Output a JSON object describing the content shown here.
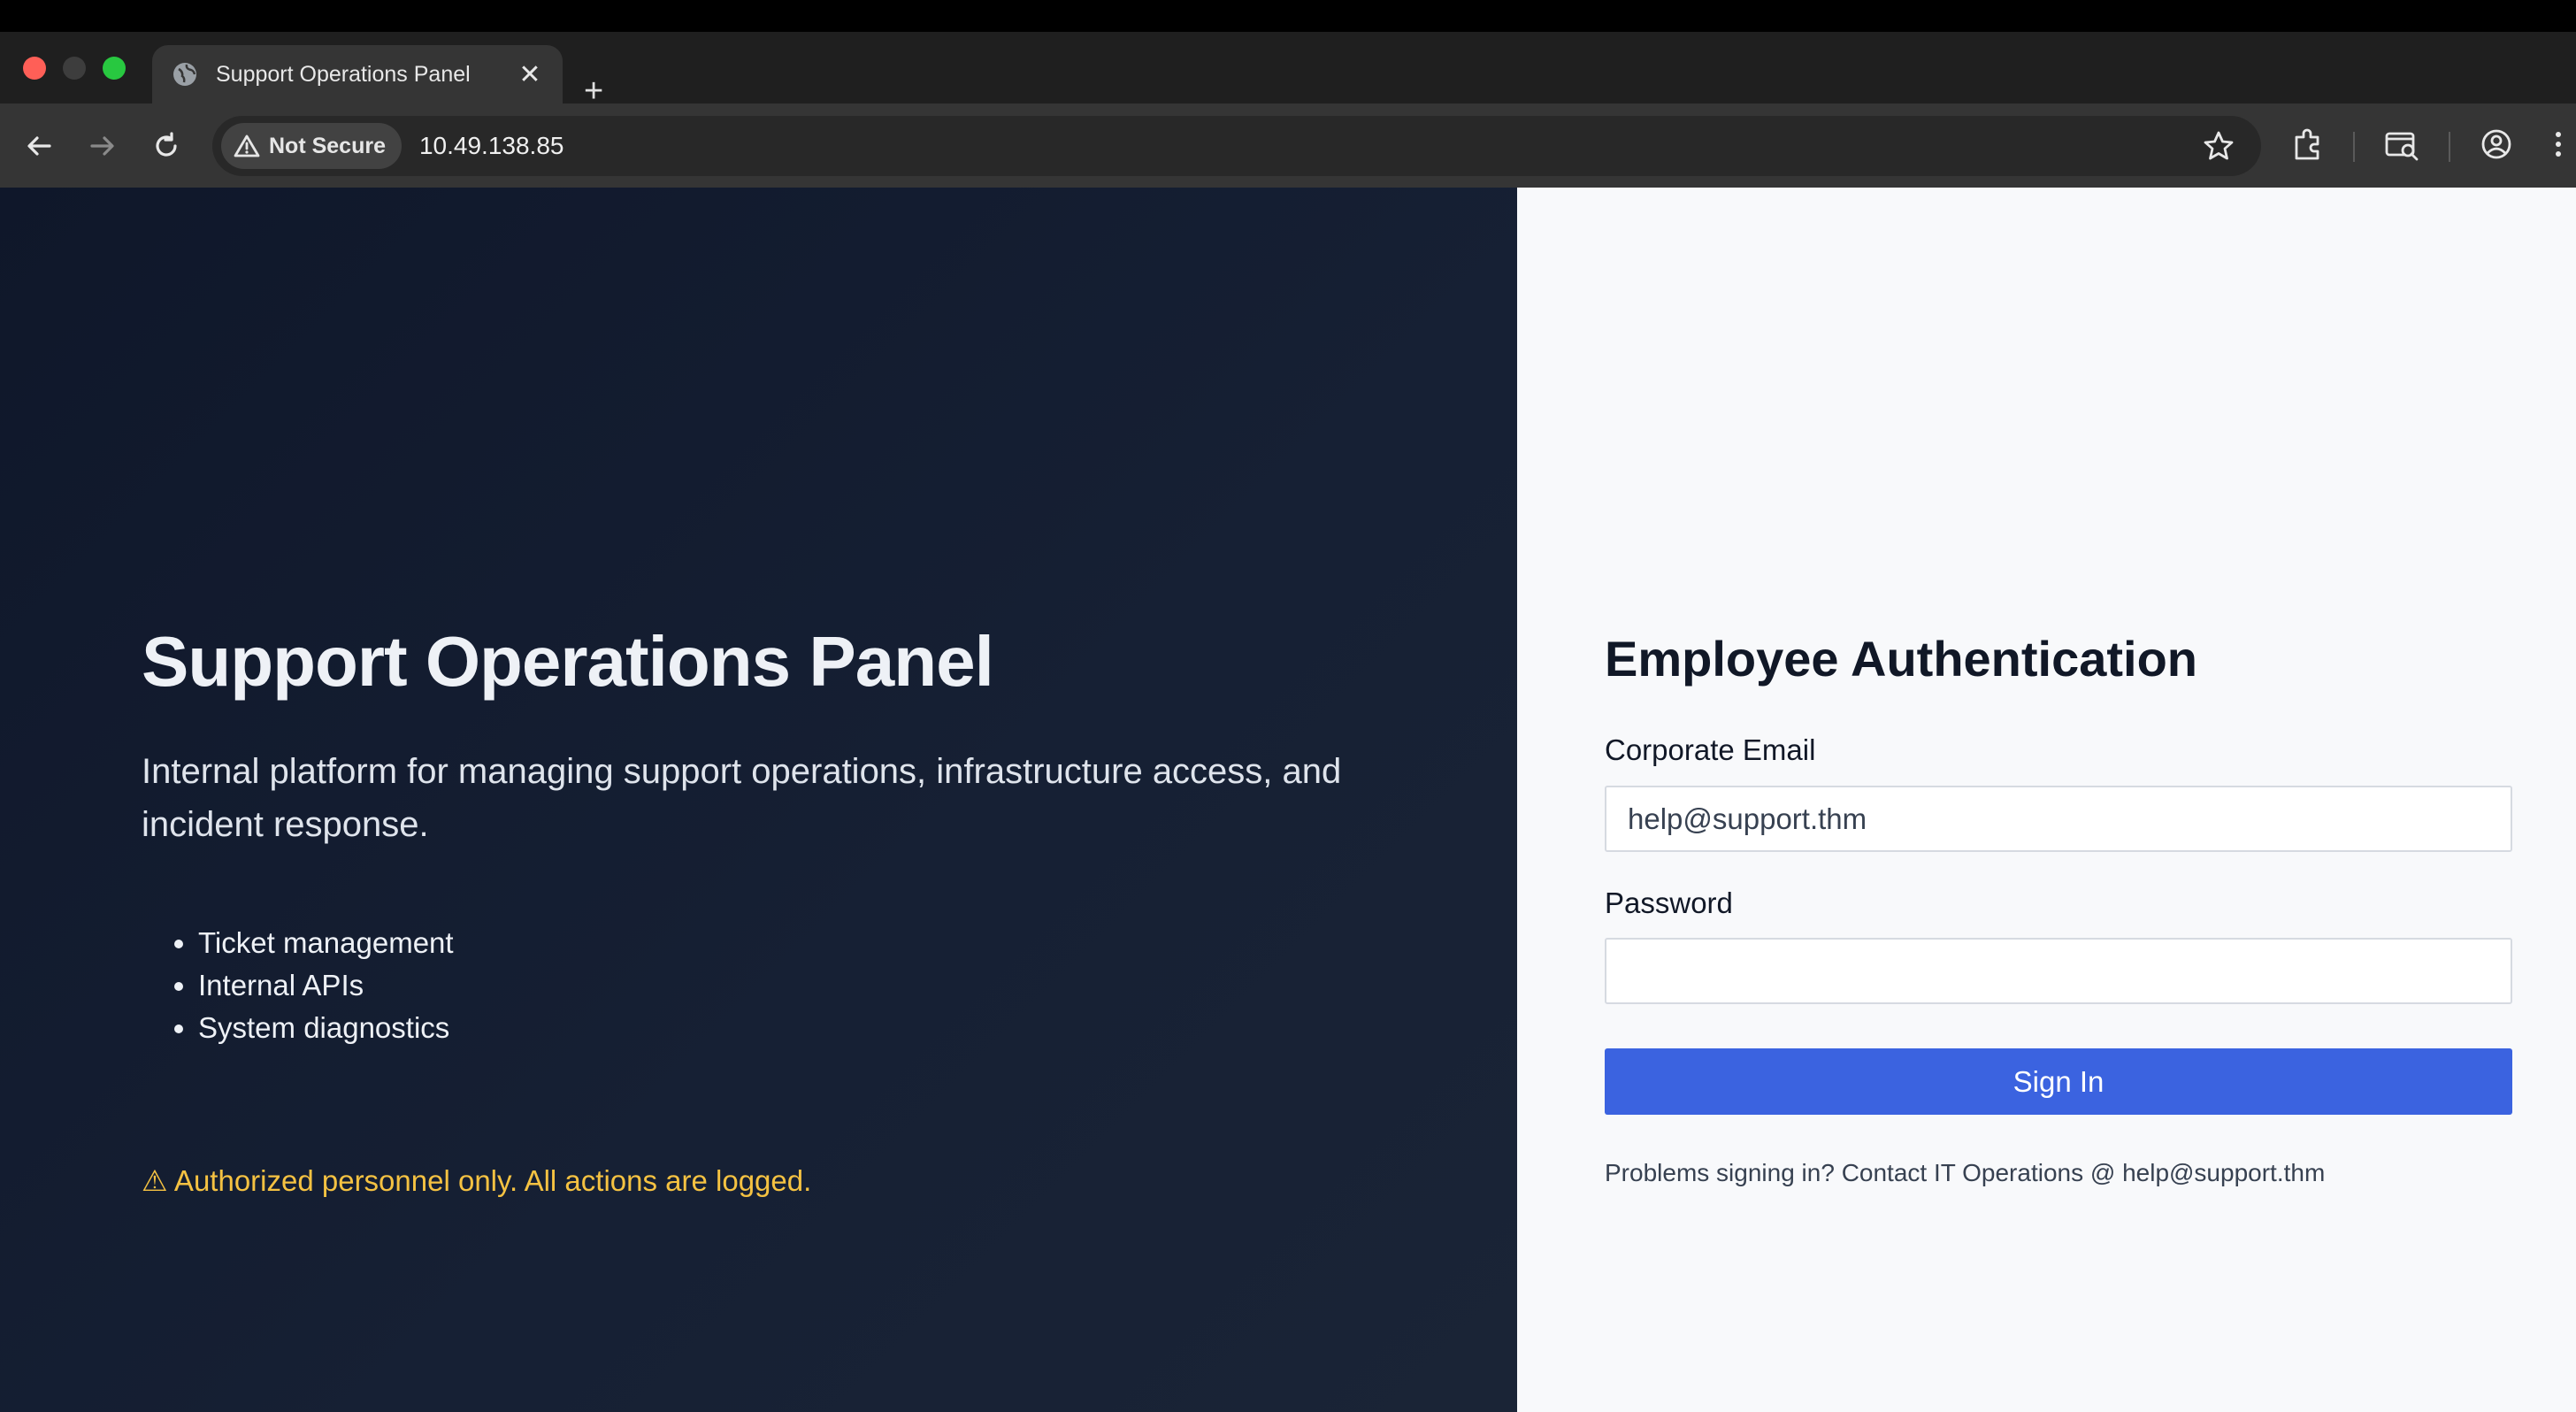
{
  "browser": {
    "tab_title": "Support Operations Panel",
    "tab_close": "✕",
    "new_tab": "+",
    "security_label": "Not Secure",
    "url": "10.49.138.85"
  },
  "hero": {
    "title": "Support Operations Panel",
    "description": "Internal platform for managing support operations, infrastructure access, and incident response.",
    "features": [
      "Ticket management",
      "Internal APIs",
      "System diagnostics"
    ],
    "warning": "⚠ Authorized personnel only. All actions are logged."
  },
  "auth": {
    "title": "Employee Authentication",
    "email_label": "Corporate Email",
    "email_value": "help@support.thm",
    "password_label": "Password",
    "password_value": "",
    "sign_in": "Sign In",
    "help_text": "Problems signing in? Contact IT Operations @ help@support.thm"
  },
  "colors": {
    "left_panel_bg": "#0f172a",
    "right_panel_bg": "#f8f9fb",
    "primary_button": "#3b63e0",
    "warning_text": "#f5c242"
  }
}
